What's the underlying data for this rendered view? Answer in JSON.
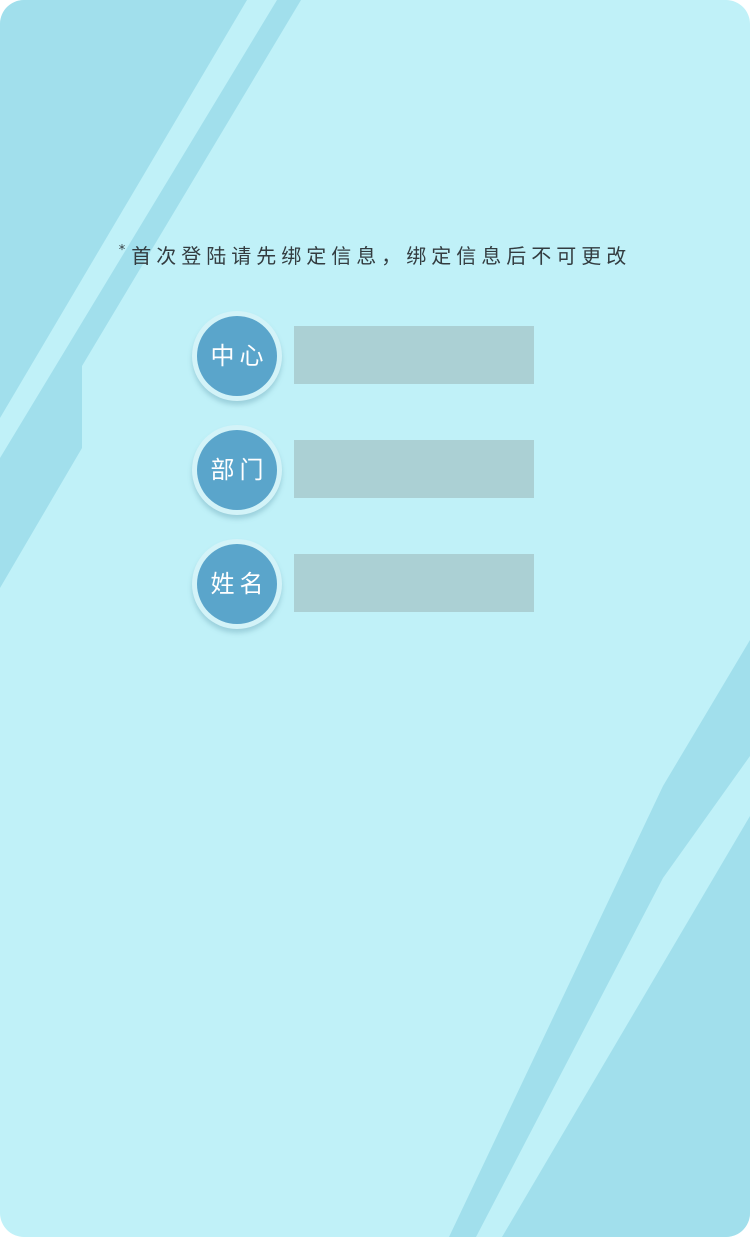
{
  "colors": {
    "background": "#c0f1f8",
    "decor": "#a1dfec",
    "badge": "#5aa5cb",
    "input": "#abd0d4"
  },
  "notice": {
    "star": "*",
    "text": "首次登陆请先绑定信息，绑定信息后不可更改"
  },
  "form": {
    "fields": [
      {
        "label": "中心",
        "value": ""
      },
      {
        "label": "部门",
        "value": ""
      },
      {
        "label": "姓名",
        "value": ""
      }
    ]
  }
}
